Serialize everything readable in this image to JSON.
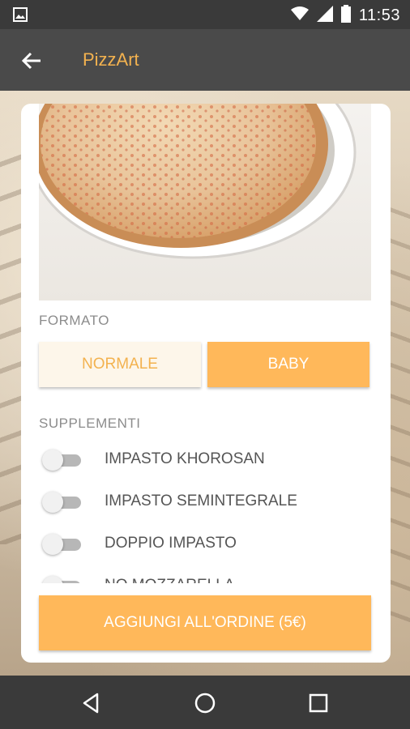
{
  "status_bar": {
    "time": "11:53",
    "icons": [
      "gallery-icon",
      "wifi-icon",
      "signal-icon",
      "battery-icon"
    ]
  },
  "app_bar": {
    "title": "PizzArt",
    "back_icon": "arrow-left-icon"
  },
  "product": {
    "image": "pizza-margherita-photo"
  },
  "formato": {
    "label": "FORMATO",
    "options": [
      {
        "label": "NORMALE",
        "selected": false
      },
      {
        "label": "BABY",
        "selected": true
      }
    ]
  },
  "supplementi": {
    "label": "SUPPLEMENTI",
    "items": [
      {
        "label": "IMPASTO KHOROSAN",
        "enabled": false
      },
      {
        "label": "IMPASTO SEMINTEGRALE",
        "enabled": false
      },
      {
        "label": "DOPPIO IMPASTO",
        "enabled": false
      },
      {
        "label": "NO MOZZARELLA",
        "enabled": false
      }
    ]
  },
  "add_button": {
    "label": "AGGIUNGI ALL'ORDINE (5€)"
  },
  "nav_bar": {
    "icons": [
      "back-triangle-icon",
      "home-circle-icon",
      "recents-square-icon"
    ]
  },
  "colors": {
    "accent": "#ffb85a",
    "accent_text": "#f3b24f",
    "app_bar": "#4a4a4a",
    "status_bar": "#3a3a3a"
  }
}
